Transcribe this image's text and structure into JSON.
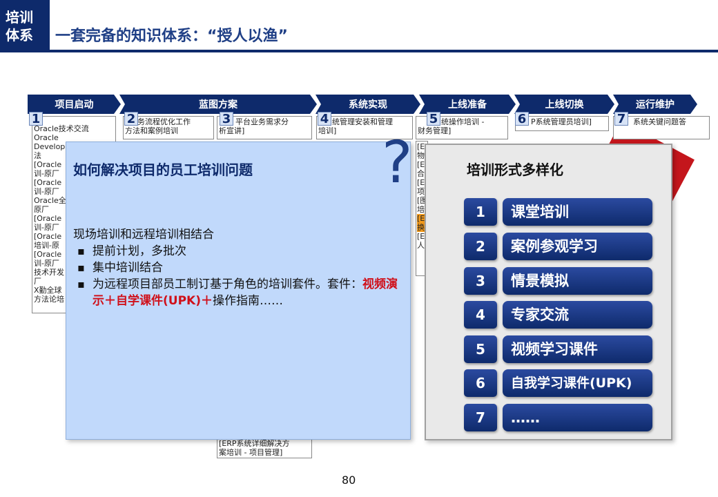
{
  "header": {
    "logo_line1": "培训",
    "logo_line2": "体系",
    "title": "一套完备的知识体系：“授人以渔”"
  },
  "phases": [
    "项目启动",
    "蓝图方案",
    "系统实现",
    "上线准备",
    "上线切换",
    "运行维护"
  ],
  "columns": [
    {
      "num": "1",
      "cells": [
        "Oracle技术交流",
        "Oracle",
        "Develop",
        "法",
        "[Oracle",
        "训-原厂",
        "[Oracle",
        "训-原厂",
        "Oracle全",
        "原厂",
        "[Oracle",
        "训-原厂",
        "[Oracle",
        "培训-原",
        "[Oracle",
        "训-原厂",
        "技术开发",
        "厂",
        "X勤全球",
        "方法论培"
      ]
    },
    {
      "num": "2",
      "cells": [
        "务流程优化工作",
        "方法和案例培训"
      ]
    },
    {
      "num": "3",
      "cells": [
        "平台业务需求分",
        "析宣讲]"
      ],
      "bottom_cells": [
        "[ERP系统详细解决方",
        "案培训 - 项目管理]"
      ]
    },
    {
      "num": "4",
      "cells": [
        "统管理安装和管理",
        "培训]"
      ]
    },
    {
      "num": "5",
      "cells": [
        "统操作培训 -",
        "财务管理]",
        "[E",
        "物",
        "[E",
        "合",
        "[E",
        "项",
        "[图",
        "培",
        "[E",
        "换",
        "[E",
        "人"
      ]
    },
    {
      "num": "6",
      "cells": [
        "P系统管理员培训]"
      ]
    },
    {
      "num": "7",
      "cells": [
        "系统关键问题答"
      ]
    }
  ],
  "left_panel": {
    "title": "如何解决项目的员工培训问题",
    "intro": "现场培训和远程培训相结合",
    "bullets": [
      "提前计划，多批次",
      "集中培训结合"
    ],
    "bullet3_prefix": "为远程项目部员工制订基于角色的培训套件。套件：",
    "bullet3_highlight": "视频演示＋自学课件(UPK)＋",
    "bullet3_suffix": "操作指南……",
    "question_mark": "?"
  },
  "right_panel": {
    "title": "培训形式多样化",
    "items": [
      {
        "num": "1",
        "label": "课堂培训"
      },
      {
        "num": "2",
        "label": "案例参观学习"
      },
      {
        "num": "3",
        "label": "情景模拟"
      },
      {
        "num": "4",
        "label": "专家交流"
      },
      {
        "num": "5",
        "label": "视频学习课件"
      },
      {
        "num": "6",
        "label": "自我学习课件(UPK)"
      },
      {
        "num": "7",
        "label": "……"
      }
    ]
  },
  "page_number": "80",
  "colors": {
    "navy": "#0e2a6b",
    "panel_blue": "#c1d9fb",
    "red": "#d0101a"
  }
}
